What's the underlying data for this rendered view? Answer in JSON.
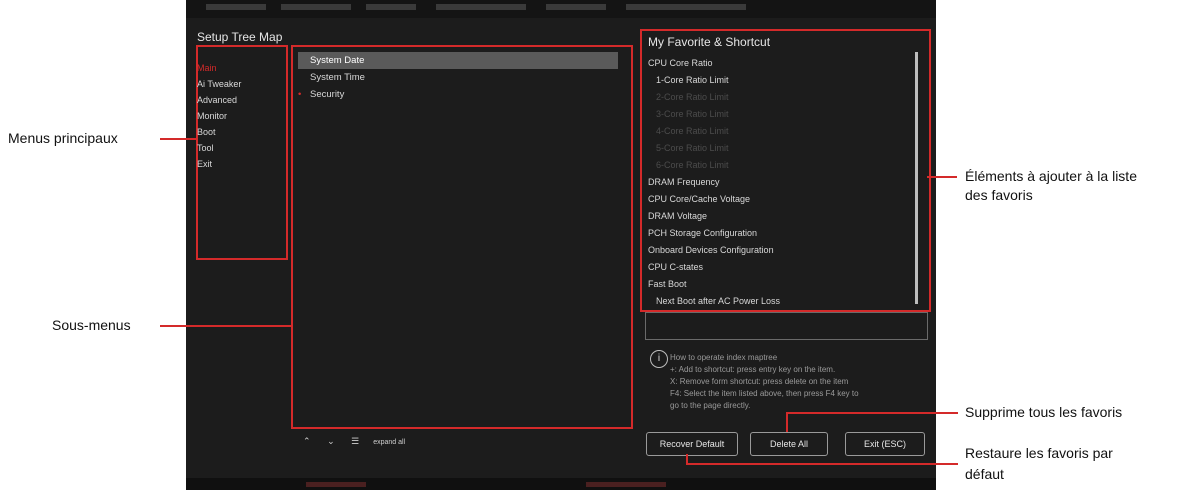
{
  "tree_map": {
    "title": "Setup Tree Map",
    "menus": [
      "Main",
      "Ai Tweaker",
      "Advanced",
      "Monitor",
      "Boot",
      "Tool",
      "Exit"
    ]
  },
  "submenus": {
    "items": [
      "System Date",
      "System Time",
      "Security"
    ]
  },
  "favorites": {
    "title": "My Favorite & Shortcut",
    "items": [
      "CPU Core Ratio",
      "1-Core Ratio Limit",
      "2-Core Ratio Limit",
      "3-Core Ratio Limit",
      "4-Core Ratio Limit",
      "5-Core Ratio Limit",
      "6-Core Ratio Limit",
      "DRAM Frequency",
      "CPU Core/Cache Voltage",
      "DRAM Voltage",
      "PCH Storage Configuration",
      "Onboard Devices Configuration",
      "CPU C-states",
      "Fast Boot",
      "Next Boot after AC Power Loss"
    ]
  },
  "help": {
    "lines": [
      "How to operate index maptree",
      "+: Add to shortcut: press entry key on the item.",
      "X: Remove form shortcut: press delete on the item",
      "F4: Select the item listed above, then press F4 key to",
      "go to the page directly."
    ]
  },
  "buttons": {
    "recover": "Recover Default",
    "delete_all": "Delete All",
    "exit": "Exit (ESC)"
  },
  "toolbar": {
    "up": "⌃",
    "down": "⌄",
    "expand": "expand all"
  },
  "annotations": {
    "main_menus": "Menus principaux",
    "submenus": "Sous-menus",
    "fav_items_1": "Éléments à ajouter à la liste",
    "fav_items_2": "des favoris",
    "delete_all": "Supprime tous les favoris",
    "recover_1": "Restaure les favoris par",
    "recover_2": "défaut"
  },
  "colors": {
    "highlight": "#d42a2a",
    "background": "#1c1c1c"
  }
}
